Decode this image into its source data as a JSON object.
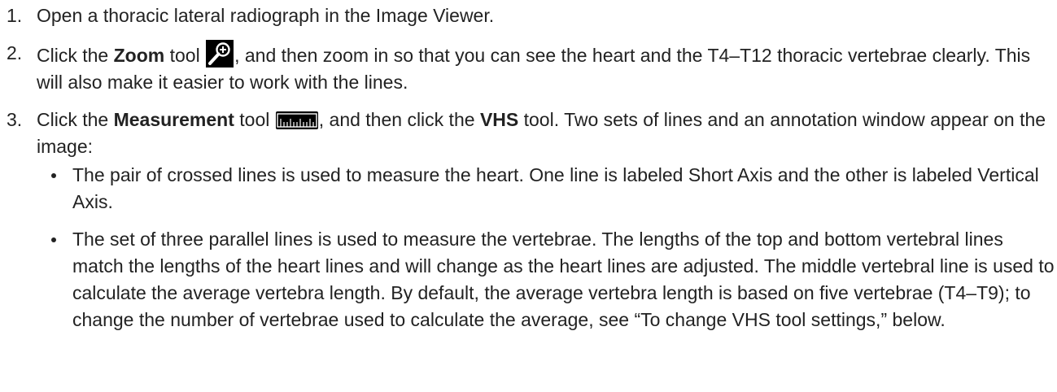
{
  "steps": [
    {
      "num": "1.",
      "text": "Open a thoracic lateral radiograph in the Image Viewer."
    },
    {
      "num": "2.",
      "prefix": "Click the ",
      "bold": "Zoom",
      "mid": " tool ",
      "icon": "zoom-in-icon",
      "suffix": ", and then zoom in so that you can see the heart and the T4–T12 thoracic vertebrae clearly. This will also make it easier to work with the lines."
    },
    {
      "num": "3.",
      "prefix": "Click the ",
      "bold": "Measurement",
      "mid": " tool ",
      "icon": "ruler-icon",
      "mid2": ", and then click the ",
      "bold2": "VHS",
      "suffix": " tool. Two sets of lines and an annotation window appear on the image:",
      "bullets": [
        "The pair of crossed lines is used to measure the heart. One line is labeled Short Axis and the other is labeled Vertical Axis.",
        "The set of three parallel lines is used to measure the vertebrae. The lengths of the top and bottom vertebral lines match the lengths of the heart lines and will change as the heart lines are adjusted. The middle vertebral line is used to calculate the average vertebra length. By default, the average vertebra length is based on five vertebrae (T4–T9); to change the number of vertebrae used to calculate the average, see “To change VHS tool settings,” below."
      ]
    }
  ],
  "colors": {
    "text": "#222222",
    "icon_bg": "#000000",
    "icon_fg": "#ffffff"
  }
}
